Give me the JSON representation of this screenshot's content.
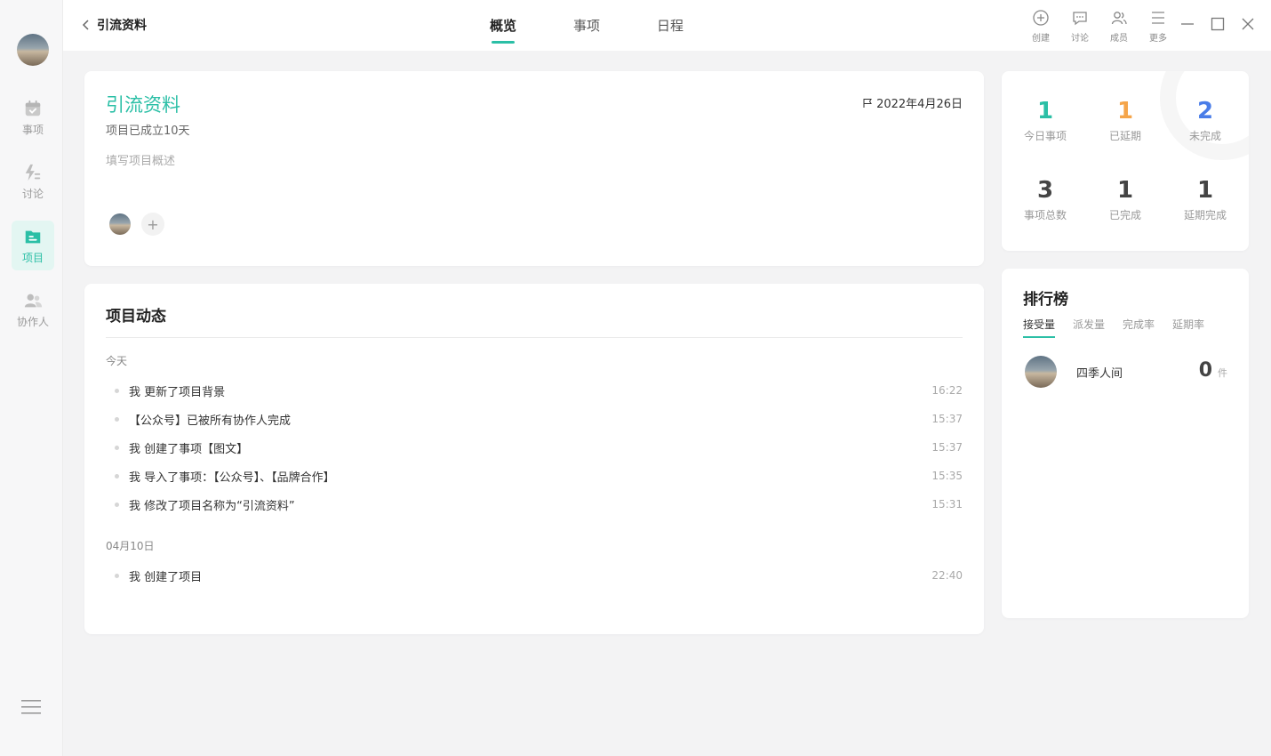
{
  "sidebar": {
    "items": [
      {
        "label": "事项",
        "icon": "calendar-check-icon"
      },
      {
        "label": "讨论",
        "icon": "discussion-icon"
      },
      {
        "label": "项目",
        "icon": "folder-icon"
      },
      {
        "label": "协作人",
        "icon": "people-icon"
      }
    ]
  },
  "header": {
    "back_title": "引流资料",
    "tabs": [
      {
        "label": "概览",
        "active": true
      },
      {
        "label": "事项"
      },
      {
        "label": "日程"
      }
    ],
    "tools": [
      {
        "label": "创建",
        "icon": "plus-circle-icon"
      },
      {
        "label": "讨论",
        "icon": "chat-icon"
      },
      {
        "label": "成员",
        "icon": "members-icon"
      },
      {
        "label": "更多",
        "icon": "more-icon"
      }
    ]
  },
  "project": {
    "title": "引流资料",
    "established": "项目已成立10天",
    "description_placeholder": "填写项目概述",
    "date": "2022年4月26日",
    "add_member": "+"
  },
  "activity": {
    "title": "项目动态",
    "groups": [
      {
        "label": "今天",
        "items": [
          {
            "text": "我 更新了项目背景",
            "time": "16:22"
          },
          {
            "text": "【公众号】已被所有协作人完成",
            "time": "15:37"
          },
          {
            "text": "我 创建了事项【图文】",
            "time": "15:37"
          },
          {
            "text": "我 导入了事项：【公众号】、【品牌合作】",
            "time": "15:35"
          },
          {
            "text": "我 修改了项目名称为“引流资料”",
            "time": "15:31"
          }
        ]
      },
      {
        "label": "04月10日",
        "items": [
          {
            "text": "我 创建了项目",
            "time": "22:40"
          }
        ]
      }
    ]
  },
  "stats": [
    {
      "value": "1",
      "label": "今日事项",
      "color": "#2bbfa6"
    },
    {
      "value": "1",
      "label": "已延期",
      "color": "#f5a54a"
    },
    {
      "value": "2",
      "label": "未完成",
      "color": "#4a7de8"
    },
    {
      "value": "3",
      "label": "事项总数",
      "color": "#444444"
    },
    {
      "value": "1",
      "label": "已完成",
      "color": "#444444"
    },
    {
      "value": "1",
      "label": "延期完成",
      "color": "#444444"
    }
  ],
  "ranking": {
    "title": "排行榜",
    "tabs": [
      "接受量",
      "派发量",
      "完成率",
      "延期率"
    ],
    "entries": [
      {
        "name": "四季人间",
        "count": "0",
        "unit": "件"
      }
    ]
  },
  "colors": {
    "accent": "#2bbfa6"
  }
}
